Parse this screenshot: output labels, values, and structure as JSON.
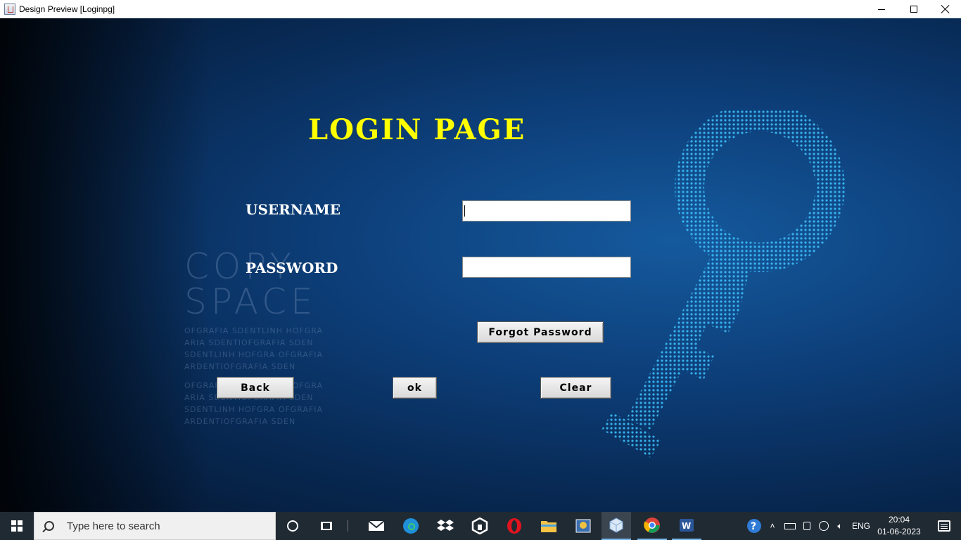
{
  "window": {
    "title": "Design Preview [Loginpg]",
    "controls": [
      "minimize",
      "maximize",
      "close"
    ]
  },
  "login": {
    "title": "LOGIN PAGE",
    "username_label": "USERNAME",
    "password_label": "PASSWORD",
    "username_value": "",
    "password_value": "",
    "forgot_label": "Forgot Password",
    "back_label": "Back",
    "ok_label": "ok",
    "clear_label": "Clear"
  },
  "background_watermark": {
    "line1": "COPY",
    "line2": "SPACE",
    "lines": [
      "OFGRAFIA SDENTLINH HOFGRA",
      "ARIA SDENTIOFGRAFIA SDEN",
      "SDENTLINH HOFGRA OFGRAFIA",
      "ARDENTIOFGRAFIA SDEN"
    ],
    "lines2": [
      "OFGRAFIA SDENTLINH HOFGRA",
      "ARIA SDENTIOFGRAFIA SDEN",
      "SDENTLINH HOFGRA OFGRAFIA",
      "ARDENTIOFGRAFIA SDEN"
    ]
  },
  "taskbar": {
    "search_placeholder": "Type here to search",
    "apps": [
      "mail",
      "edge",
      "dropbox",
      "hexagon-app",
      "opera",
      "file-explorer",
      "photo-viewer",
      "java-app",
      "chrome",
      "word"
    ],
    "tray": {
      "language": "ENG",
      "time": "20:04",
      "date": "01-06-2023"
    }
  },
  "colors": {
    "title_yellow": "#ffff00",
    "label_white": "#ffffff",
    "panel_blue": "#0d3f7a",
    "taskbar": "#202a33"
  }
}
